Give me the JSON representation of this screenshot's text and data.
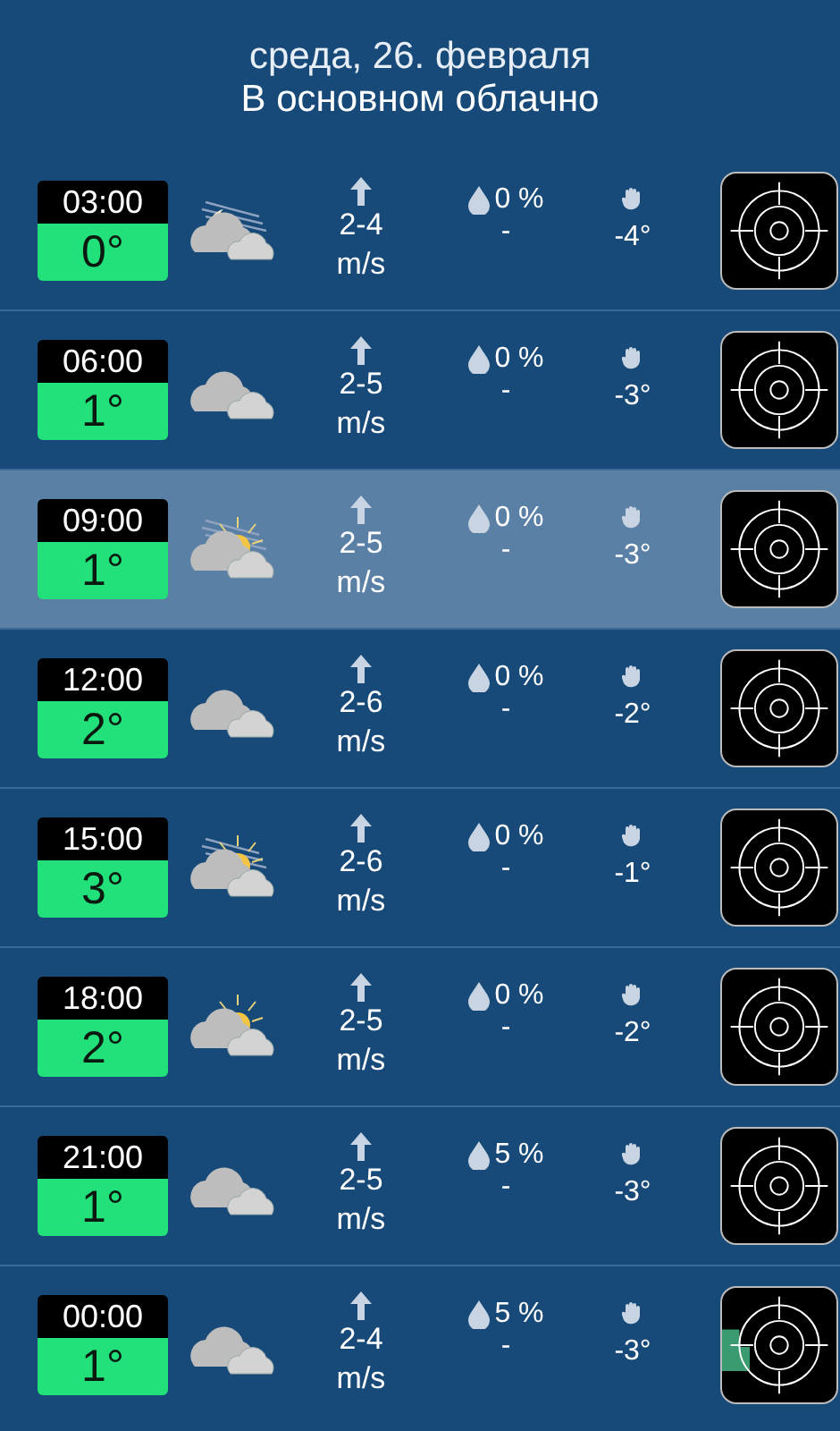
{
  "header": {
    "date": "среда, 26. февраля",
    "summary": "В основном облачно"
  },
  "rows": [
    {
      "time": "03:00",
      "temp": "0°",
      "kind": "moon-cloud",
      "wind": "2-4 m/s",
      "precip_chance": "0 %",
      "precip_amount": "-",
      "feels": "-4°",
      "selected": false,
      "radar_echo": false
    },
    {
      "time": "06:00",
      "temp": "1°",
      "kind": "cloud",
      "wind": "2-5 m/s",
      "precip_chance": "0 %",
      "precip_amount": "-",
      "feels": "-3°",
      "selected": false,
      "radar_echo": false
    },
    {
      "time": "09:00",
      "temp": "1°",
      "kind": "sun-cloud-haze",
      "wind": "2-5 m/s",
      "precip_chance": "0 %",
      "precip_amount": "-",
      "feels": "-3°",
      "selected": true,
      "radar_echo": false
    },
    {
      "time": "12:00",
      "temp": "2°",
      "kind": "cloud",
      "wind": "2-6 m/s",
      "precip_chance": "0 %",
      "precip_amount": "-",
      "feels": "-2°",
      "selected": false,
      "radar_echo": false
    },
    {
      "time": "15:00",
      "temp": "3°",
      "kind": "sun-cloud-haze",
      "wind": "2-6 m/s",
      "precip_chance": "0 %",
      "precip_amount": "-",
      "feels": "-1°",
      "selected": false,
      "radar_echo": false
    },
    {
      "time": "18:00",
      "temp": "2°",
      "kind": "sun-cloud",
      "wind": "2-5 m/s",
      "precip_chance": "0 %",
      "precip_amount": "-",
      "feels": "-2°",
      "selected": false,
      "radar_echo": false
    },
    {
      "time": "21:00",
      "temp": "1°",
      "kind": "cloud",
      "wind": "2-5 m/s",
      "precip_chance": "5 %",
      "precip_amount": "-",
      "feels": "-3°",
      "selected": false,
      "radar_echo": false
    },
    {
      "time": "00:00",
      "temp": "1°",
      "kind": "cloud",
      "wind": "2-4 m/s",
      "precip_chance": "5 %",
      "precip_amount": "-",
      "feels": "-3°",
      "selected": false,
      "radar_echo": true
    }
  ]
}
